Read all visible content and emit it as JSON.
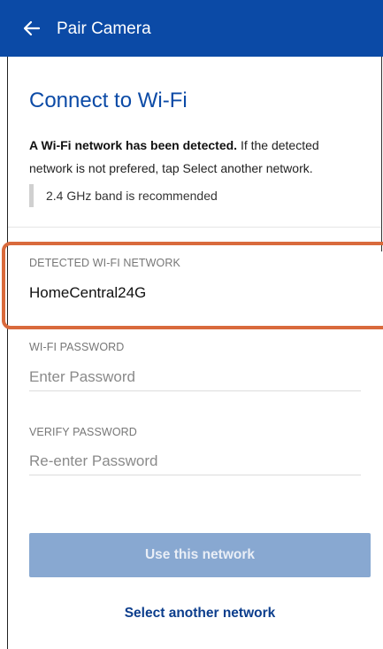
{
  "header": {
    "title": "Pair Camera",
    "back_icon": "arrow-left-icon",
    "background_color": "#0b4aa6"
  },
  "main": {
    "heading": "Connect to Wi-Fi",
    "description_bold": "A Wi-Fi network has been detected.",
    "description_rest": " If the detected network is not prefered, tap Select another network.",
    "note": "2.4 GHz band is recommended"
  },
  "detected_network": {
    "label": "DETECTED WI-FI NETWORK",
    "value": "HomeCentral24G",
    "highlight_color": "#d96a3c"
  },
  "password": {
    "label": "WI-FI PASSWORD",
    "placeholder": "Enter Password"
  },
  "verify_password": {
    "label": "VERIFY PASSWORD",
    "placeholder": "Re-enter Password"
  },
  "actions": {
    "use_network_label": "Use this network",
    "use_network_color": "#88a8d1",
    "select_another_label": "Select another network",
    "link_color": "#0b3d8c"
  }
}
